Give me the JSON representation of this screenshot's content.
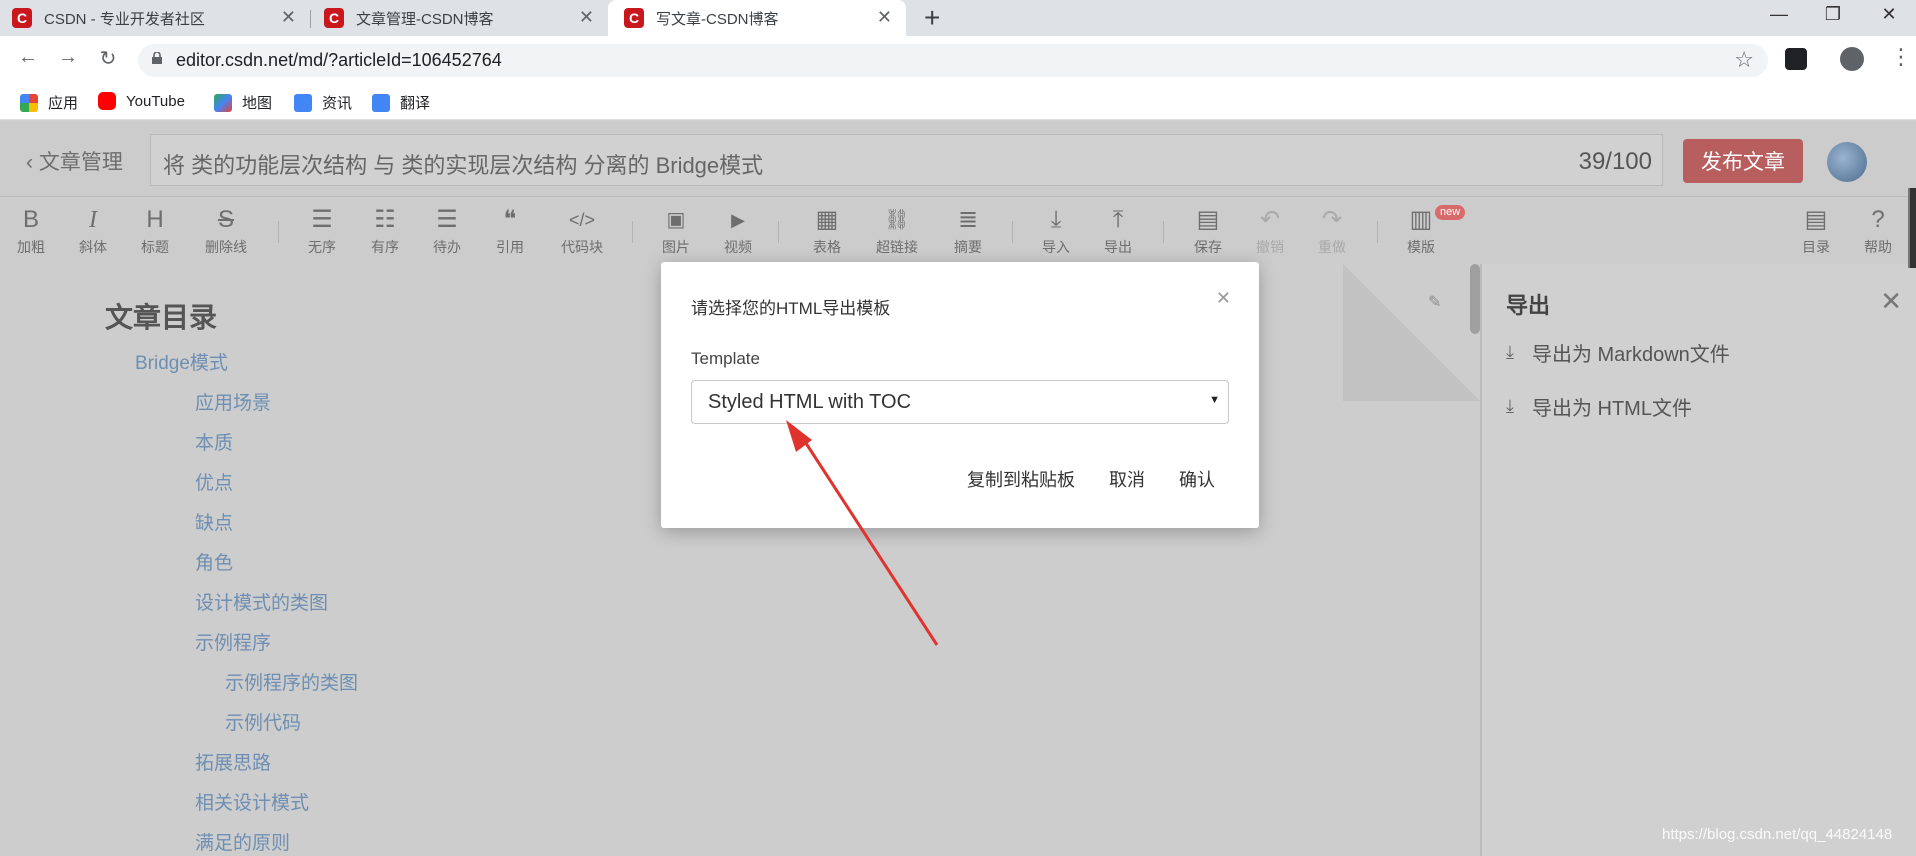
{
  "browser": {
    "tabs": [
      {
        "title": "CSDN - 专业开发者社区",
        "favicon": "C",
        "active": false
      },
      {
        "title": "文章管理-CSDN博客",
        "favicon": "C",
        "active": false
      },
      {
        "title": "写文章-CSDN博客",
        "favicon": "C",
        "active": true
      }
    ],
    "new_tab": "+",
    "url": "editor.csdn.net/md/?articleId=106452764",
    "bookmarks": [
      {
        "label": "应用",
        "icon": "apps-grid-icon"
      },
      {
        "label": "YouTube",
        "icon": "youtube-icon"
      },
      {
        "label": "地图",
        "icon": "maps-icon"
      },
      {
        "label": "资讯",
        "icon": "news-icon"
      },
      {
        "label": "翻译",
        "icon": "translate-icon"
      }
    ]
  },
  "editor": {
    "back_label": "文章管理",
    "article_title": "将  类的功能层次结构  与  类的实现层次结构  分离的  Bridge模式",
    "title_count": "39/100",
    "publish_label": "发布文章",
    "toolbar": [
      {
        "glyph": "B",
        "label": "加粗"
      },
      {
        "glyph": "I",
        "label": "斜体"
      },
      {
        "glyph": "H",
        "label": "标题"
      },
      {
        "glyph": "S",
        "label": "删除线"
      },
      {
        "glyph": "☰",
        "label": "无序"
      },
      {
        "glyph": "☷",
        "label": "有序"
      },
      {
        "glyph": "☰",
        "label": "待办"
      },
      {
        "glyph": "❝",
        "label": "引用"
      },
      {
        "glyph": "</>",
        "label": "代码块"
      },
      {
        "glyph": "▣",
        "label": "图片"
      },
      {
        "glyph": "▶",
        "label": "视频"
      },
      {
        "glyph": "▦",
        "label": "表格"
      },
      {
        "glyph": "⛓",
        "label": "超链接"
      },
      {
        "glyph": "≣",
        "label": "摘要"
      },
      {
        "glyph": "⤓",
        "label": "导入"
      },
      {
        "glyph": "⤒",
        "label": "导出"
      },
      {
        "glyph": "▤",
        "label": "保存"
      },
      {
        "glyph": "↶",
        "label": "撤销"
      },
      {
        "glyph": "↷",
        "label": "重做"
      },
      {
        "glyph": "▥",
        "label": "模版"
      },
      {
        "glyph": "▤",
        "label": "目录"
      },
      {
        "glyph": "?",
        "label": "帮助"
      }
    ],
    "new_badge": "new"
  },
  "toc": {
    "title": "文章目录",
    "items": [
      "Bridge模式",
      "应用场景",
      "本质",
      "优点",
      "缺点",
      "角色",
      "设计模式的类图",
      "示例程序",
      "示例程序的类图",
      "示例代码",
      "拓展思路",
      "相关设计模式",
      "满足的原则"
    ]
  },
  "export_panel": {
    "title": "导出",
    "items": [
      "导出为 Markdown文件",
      "导出为 HTML文件"
    ]
  },
  "modal": {
    "title": "请选择您的HTML导出模板",
    "template_label": "Template",
    "template_value": "Styled HTML with TOC",
    "copy_label": "复制到粘贴板",
    "cancel_label": "取消",
    "confirm_label": "确认"
  },
  "watermark": "https://blog.csdn.net/qq_44824148"
}
